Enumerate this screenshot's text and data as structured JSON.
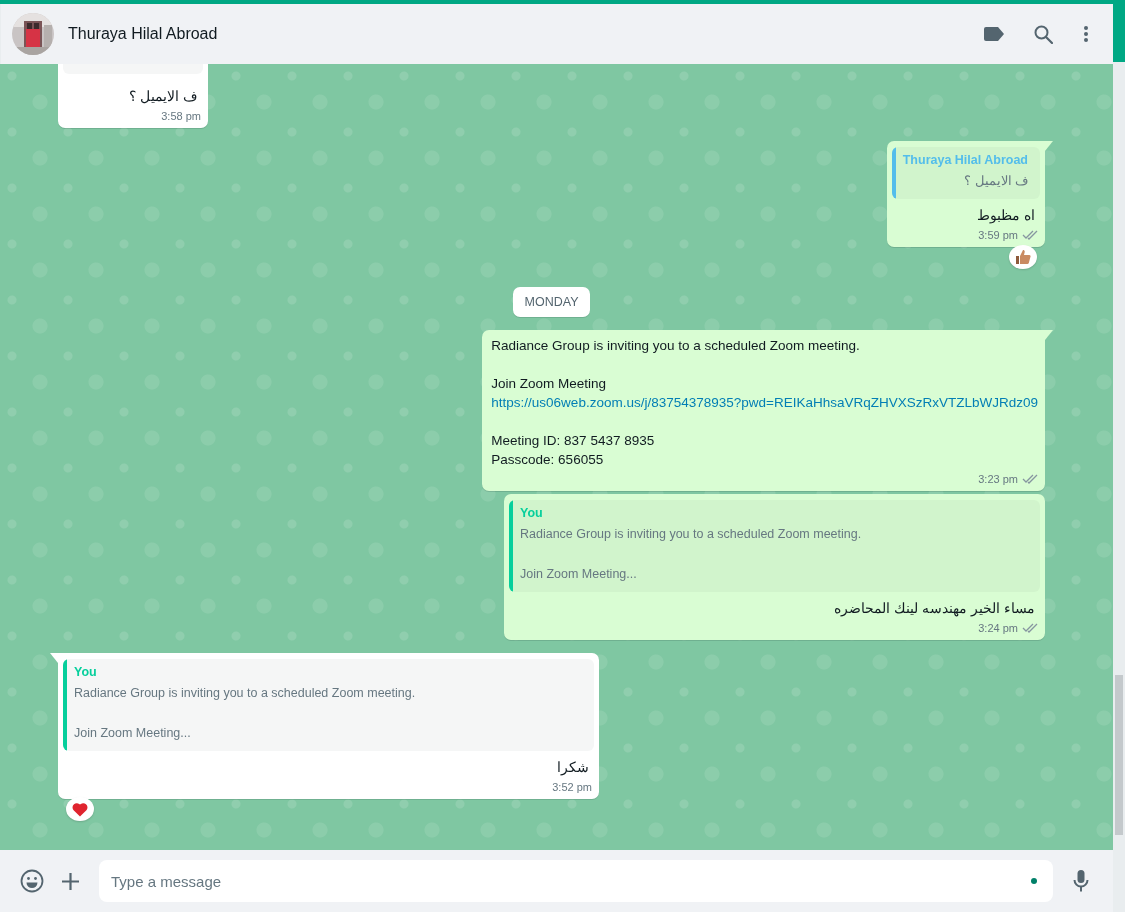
{
  "header": {
    "title": "Thuraya Hilal Abroad"
  },
  "messages": [
    {
      "kind": "incoming",
      "cut_off": true,
      "tail": false,
      "text": "ف الايميل ؟",
      "time": "3:58 pm"
    },
    {
      "kind": "outgoing",
      "tail": true,
      "quote": {
        "author": "Thuraya Hilal Abroad",
        "color": "#53bdeb",
        "paragraphs": [
          "ف الايميل ؟"
        ]
      },
      "text": "اه مظبوط",
      "time": "3:59 pm",
      "delivered": true,
      "read": false,
      "reaction": {
        "kind": "thumbs_up"
      }
    },
    {
      "kind": "date",
      "label": "MONDAY"
    },
    {
      "kind": "outgoing",
      "tail": true,
      "paragraphs": [
        [
          {
            "kind": "text",
            "text": "Radiance Group is inviting you to a scheduled Zoom meeting."
          }
        ],
        [
          {
            "kind": "text",
            "text": "Join Zoom Meeting"
          },
          {
            "kind": "link",
            "text": "https://us06web.zoom.us/j/83754378935?pwd=REIKaHhsaVRqZHVXSzRxVTZLbWJRdz09"
          }
        ],
        [
          {
            "kind": "text",
            "text": "Meeting ID: 837 5437 8935"
          },
          {
            "kind": "text",
            "text": "Passcode: 656055"
          }
        ]
      ],
      "time": "3:23 pm",
      "delivered": true,
      "read": false
    },
    {
      "kind": "outgoing",
      "tail": false,
      "quote": {
        "author": "You",
        "color": "#06cf9c",
        "paragraphs": [
          "Radiance Group is inviting you to a scheduled Zoom meeting.",
          "Join Zoom Meeting..."
        ]
      },
      "text": "مساء الخير مهندسه لينك المحاضره",
      "time": "3:24 pm",
      "delivered": true,
      "read": false
    },
    {
      "kind": "incoming",
      "tail": true,
      "quote": {
        "author": "You",
        "color": "#06cf9c",
        "paragraphs": [
          "Radiance Group is inviting you to a scheduled Zoom meeting.",
          "Join Zoom Meeting..."
        ]
      },
      "text": "شكرا",
      "time": "3:52 pm",
      "reaction": {
        "kind": "heart"
      }
    }
  ],
  "composer": {
    "placeholder": "Type a message"
  }
}
